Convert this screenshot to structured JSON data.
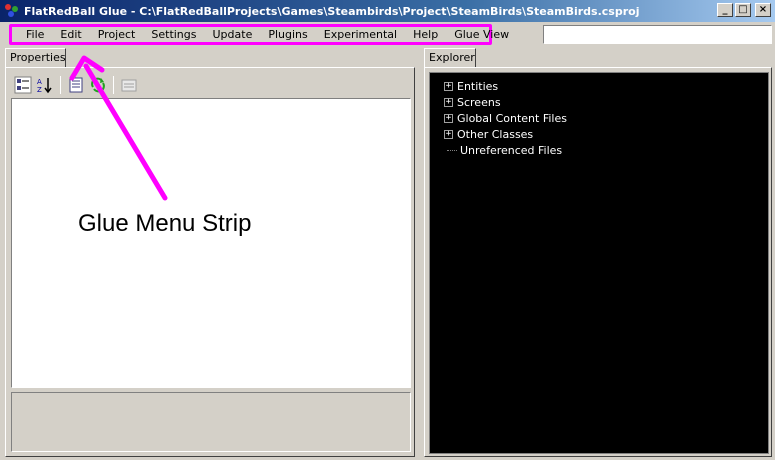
{
  "window": {
    "title": "FlatRedBall Glue - C:\\FlatRedBallProjects\\Games\\Steambirds\\Project\\SteamBirds\\SteamBirds.csproj",
    "minimize_label": "_",
    "maximize_label": "□",
    "close_label": "×"
  },
  "menu": {
    "items": [
      "File",
      "Edit",
      "Project",
      "Settings",
      "Update",
      "Plugins",
      "Experimental",
      "Help",
      "Glue View"
    ],
    "search_value": ""
  },
  "left": {
    "tab_label": "Properties",
    "toolbar_icons": [
      "categorized-icon",
      "alphabetical-icon",
      "properties-icon",
      "events-icon",
      "property-pages-icon"
    ]
  },
  "right": {
    "tab_label": "Explorer",
    "tree": [
      {
        "label": "Entities",
        "expander": "+"
      },
      {
        "label": "Screens",
        "expander": "+"
      },
      {
        "label": "Global Content Files",
        "expander": "+"
      },
      {
        "label": "Other Classes",
        "expander": "+"
      },
      {
        "label": "Unreferenced Files",
        "expander": ""
      }
    ]
  },
  "annotation": {
    "text": "Glue Menu Strip",
    "color": "#ff00ff"
  }
}
